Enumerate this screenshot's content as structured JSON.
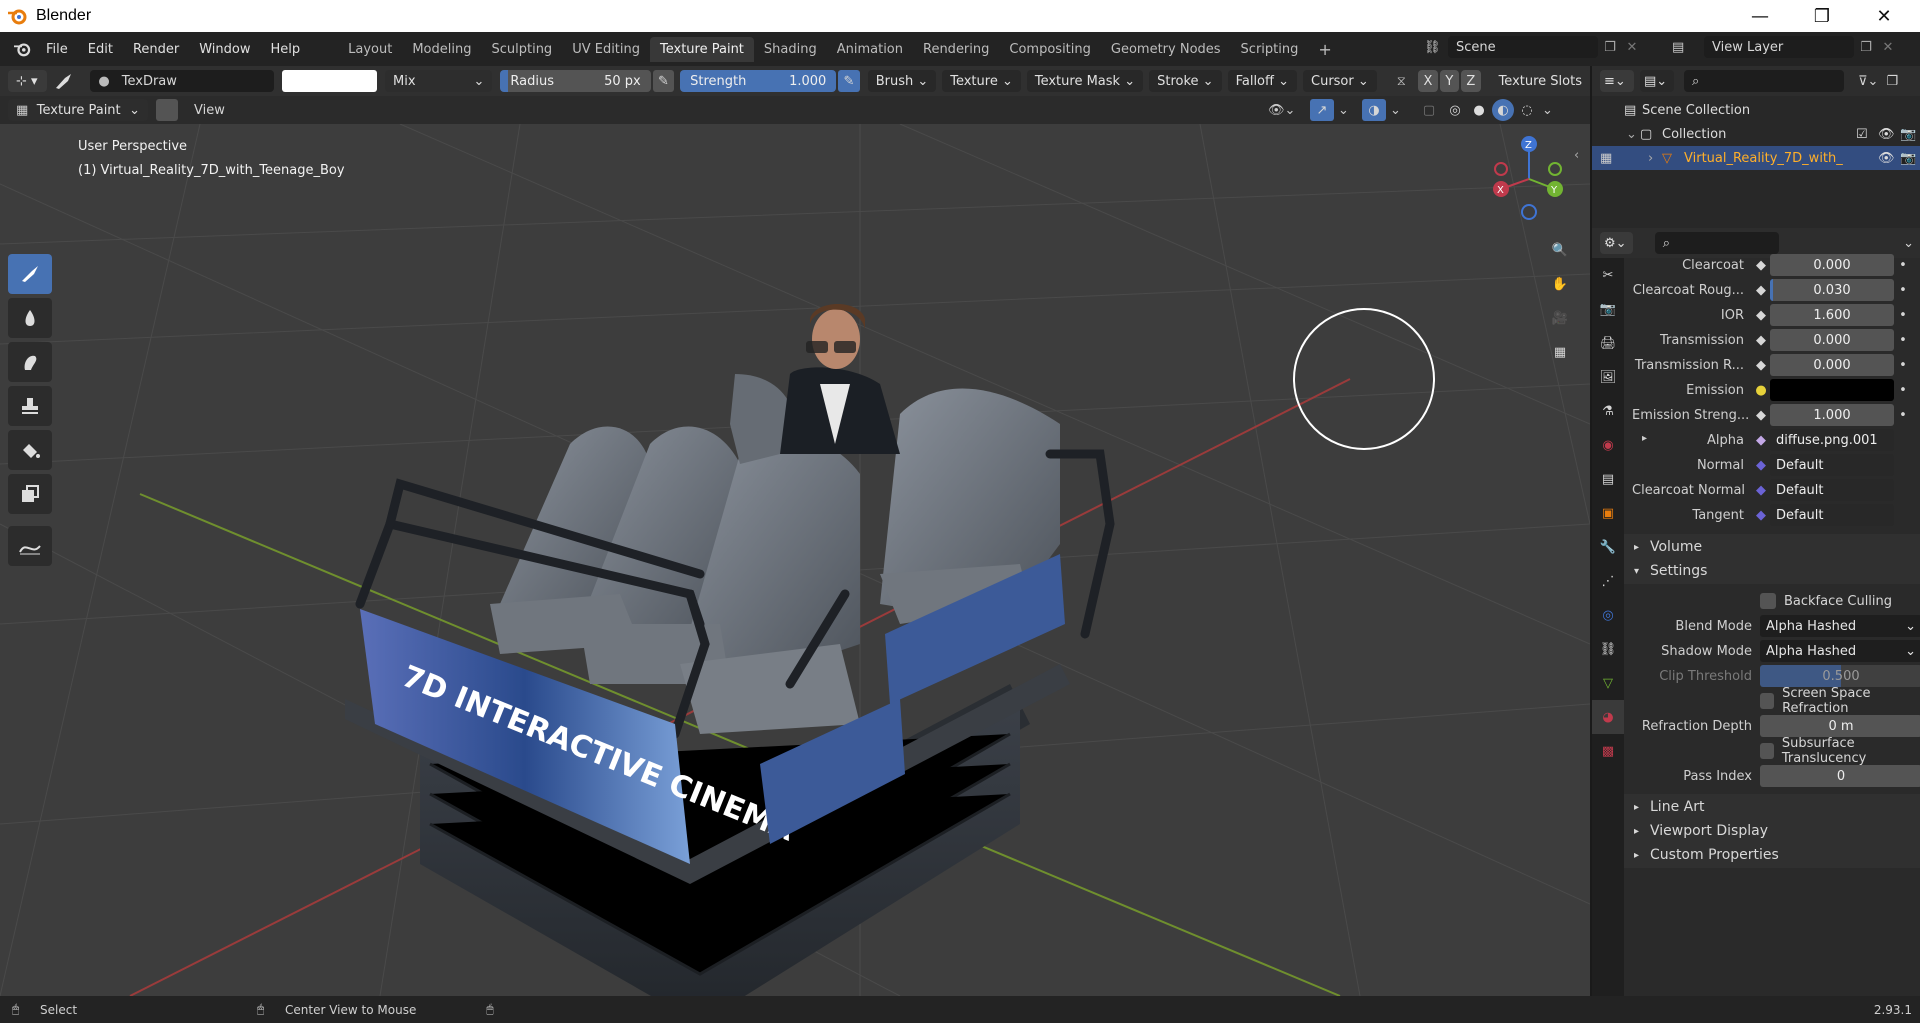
{
  "window": {
    "title": "Blender"
  },
  "menu": {
    "file": "File",
    "edit": "Edit",
    "render": "Render",
    "window": "Window",
    "help": "Help"
  },
  "workspaces": [
    "Layout",
    "Modeling",
    "Sculpting",
    "UV Editing",
    "Texture Paint",
    "Shading",
    "Animation",
    "Rendering",
    "Compositing",
    "Geometry Nodes",
    "Scripting"
  ],
  "active_workspace": "Texture Paint",
  "scene": {
    "scene_name": "Scene",
    "view_layer": "View Layer"
  },
  "tool_header": {
    "brush_name": "TexDraw",
    "color": "#ffffff",
    "blend": "Mix",
    "radius_label": "Radius",
    "radius_value": "50 px",
    "strength_label": "Strength",
    "strength_value": "1.000",
    "brush": "Brush",
    "texture": "Texture",
    "texture_mask": "Texture Mask",
    "stroke": "Stroke",
    "falloff": "Falloff",
    "cursor": "Cursor",
    "axis_x": "X",
    "axis_y": "Y",
    "axis_z": "Z",
    "texture_slots": "Texture Slots"
  },
  "mode_header": {
    "mode": "Texture Paint",
    "view": "View"
  },
  "viewport": {
    "perspective": "User Perspective",
    "object_label": "(1) Virtual_Reality_7D_with_Teenage_Boy",
    "gizmo": {
      "x": "X",
      "y": "Y",
      "z": "Z"
    },
    "banner_text": "7D INTERACTIVE CINEMA"
  },
  "outliner": {
    "scene_collection": "Scene Collection",
    "collection": "Collection",
    "object": "Virtual_Reality_7D_with_"
  },
  "properties": {
    "rows": [
      {
        "label": "Clearcoat",
        "value": "0.000",
        "kind": "slider"
      },
      {
        "label": "Clearcoat Roug...",
        "value": "0.030",
        "kind": "slider"
      },
      {
        "label": "IOR",
        "value": "1.600",
        "kind": "slider"
      },
      {
        "label": "Transmission",
        "value": "0.000",
        "kind": "slider"
      },
      {
        "label": "Transmission R...",
        "value": "0.000",
        "kind": "slider"
      },
      {
        "label": "Emission",
        "value": "",
        "kind": "color"
      },
      {
        "label": "Emission Streng...",
        "value": "1.000",
        "kind": "slider"
      },
      {
        "label": "Alpha",
        "value": "diffuse.png.001",
        "kind": "link"
      },
      {
        "label": "Normal",
        "value": "Default",
        "kind": "link"
      },
      {
        "label": "Clearcoat Normal",
        "value": "Default",
        "kind": "link"
      },
      {
        "label": "Tangent",
        "value": "Default",
        "kind": "link"
      }
    ],
    "volume": "Volume",
    "settings": "Settings",
    "backface_culling": "Backface Culling",
    "blend_mode_label": "Blend Mode",
    "blend_mode": "Alpha Hashed",
    "shadow_mode_label": "Shadow Mode",
    "shadow_mode": "Alpha Hashed",
    "clip_threshold_label": "Clip Threshold",
    "clip_threshold": "0.500",
    "ssr": "Screen Space Refraction",
    "refraction_depth_label": "Refraction Depth",
    "refraction_depth": "0 m",
    "subsurface": "Subsurface Translucency",
    "pass_index_label": "Pass Index",
    "pass_index": "0",
    "line_art": "Line Art",
    "viewport_display": "Viewport Display",
    "custom_properties": "Custom Properties"
  },
  "status": {
    "select": "Select",
    "center": "Center View to Mouse",
    "version": "2.93.1"
  },
  "colors": {
    "accent": "#4772b3",
    "active_orange": "#e87d0d",
    "x_axis": "#c03a4c",
    "y_axis": "#72b432",
    "z_axis": "#3f74d4"
  }
}
